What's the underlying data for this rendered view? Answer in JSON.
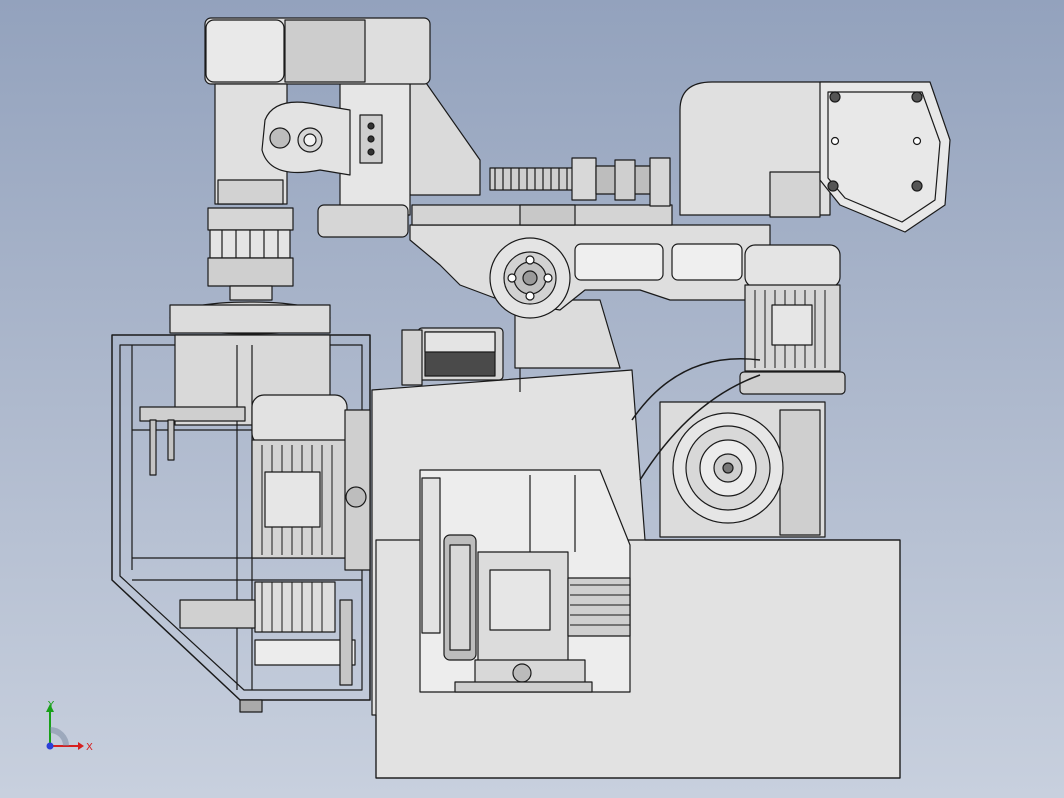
{
  "window": {
    "title": ""
  },
  "viewport": {
    "background_top": "#93a2bd",
    "background_bottom": "#c8d0de",
    "model_fill": "#e2e2e2",
    "model_edge": "#1a1a1a"
  },
  "triad": {
    "x_label": "X",
    "y_label": "Y",
    "x_color": "#d62020",
    "y_color": "#18a018",
    "z_color": "#2a3fd8"
  }
}
